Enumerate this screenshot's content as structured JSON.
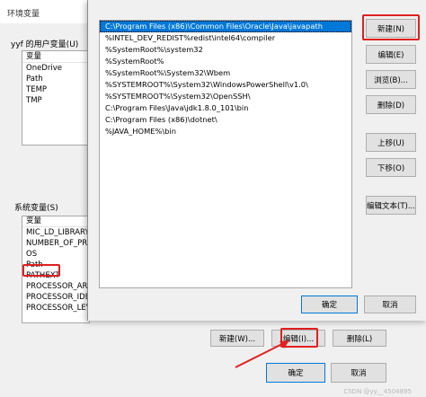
{
  "env_window": {
    "title": "环境变量",
    "user_vars_label": "yyf 的用户变量(U)",
    "user_vars_header": "变量",
    "user_vars": [
      "OneDrive",
      "Path",
      "TEMP",
      "TMP"
    ],
    "system_vars_label": "系统变量(S)",
    "system_vars_header": "变量",
    "system_vars": [
      "MIC_LD_LIBRARY_",
      "NUMBER_OF_PRO",
      "OS",
      "Path",
      "PATHEXT",
      "PROCESSOR_ARC",
      "PROCESSOR_IDEN",
      "PROCESSOR_LEV"
    ],
    "buttons": {
      "new": "新建(W)...",
      "edit": "编辑(I)...",
      "delete": "删除(L)"
    },
    "ok": "确定",
    "cancel": "取消"
  },
  "edit_dialog": {
    "paths": [
      "C:\\Program Files (x86)\\Common Files\\Oracle\\Java\\javapath",
      "%INTEL_DEV_REDIST%redist\\intel64\\compiler",
      "%SystemRoot%\\system32",
      "%SystemRoot%",
      "%SystemRoot%\\System32\\Wbem",
      "%SYSTEMROOT%\\System32\\WindowsPowerShell\\v1.0\\",
      "%SYSTEMROOT%\\System32\\OpenSSH\\",
      "C:\\Program Files\\Java\\jdk1.8.0_101\\bin",
      "C:\\Program Files (x86)\\dotnet\\",
      "%JAVA_HOME%\\bin"
    ],
    "buttons": {
      "new": "新建(N)",
      "edit": "编辑(E)",
      "browse": "浏览(B)...",
      "delete": "删除(D)",
      "move_up": "上移(U)",
      "move_down": "下移(O)",
      "edit_text": "编辑文本(T)..."
    },
    "ok": "确定",
    "cancel": "取消"
  },
  "watermark": "CSDN @yy__4504895",
  "colors": {
    "selection": "#0078d7",
    "highlight": "#e02020",
    "dialog_bg": "#f0f0f0"
  }
}
